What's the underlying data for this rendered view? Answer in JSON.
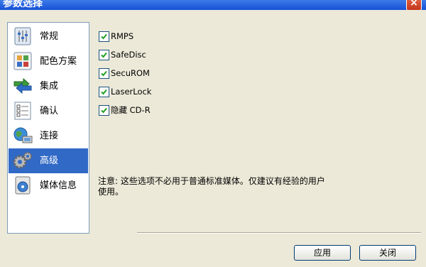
{
  "window": {
    "title": "参数选择",
    "close_glyph": "×"
  },
  "sidebar": {
    "items": [
      {
        "label": "常规",
        "icon": "general-settings-icon"
      },
      {
        "label": "配色方案",
        "icon": "color-scheme-icon"
      },
      {
        "label": "集成",
        "icon": "integration-icon"
      },
      {
        "label": "确认",
        "icon": "confirm-icon"
      },
      {
        "label": "连接",
        "icon": "connection-icon"
      },
      {
        "label": "高级",
        "icon": "gears-icon",
        "selected": true
      },
      {
        "label": "媒体信息",
        "icon": "media-info-icon"
      }
    ]
  },
  "options": [
    {
      "label": "RMPS",
      "checked": true
    },
    {
      "label": "SafeDisc",
      "checked": true
    },
    {
      "label": "SecuROM",
      "checked": true
    },
    {
      "label": "LaserLock",
      "checked": true
    },
    {
      "label": "隐藏 CD-R",
      "checked": true
    }
  ],
  "note": {
    "line1": "注意: 这些选项不必用于普通标准媒体。仅建议有经验的用户",
    "line2": "使用。"
  },
  "buttons": {
    "apply": "应用",
    "close": "关闭"
  }
}
